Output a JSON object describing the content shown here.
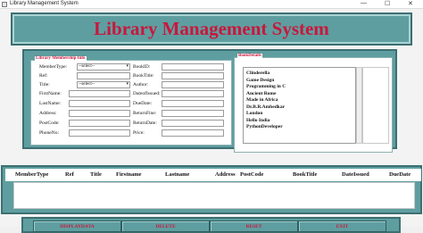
{
  "window": {
    "title": "Library Management System",
    "controls": {
      "minimize": "—",
      "maximize": "☐",
      "close": "✕"
    }
  },
  "banner": {
    "title": "Library Management System"
  },
  "member_info": {
    "legend": "Library Membership Info",
    "left_fields": [
      {
        "label": "MemberType:",
        "type": "select",
        "value": "--select--"
      },
      {
        "label": "Ref:",
        "type": "input",
        "value": ""
      },
      {
        "label": "Title:",
        "type": "select",
        "value": "--select--"
      },
      {
        "label": "FirstName:",
        "type": "input",
        "value": ""
      },
      {
        "label": "LastName:",
        "type": "input",
        "value": ""
      },
      {
        "label": "Address:",
        "type": "input",
        "value": ""
      },
      {
        "label": "PostCode:",
        "type": "input",
        "value": ""
      },
      {
        "label": "PhoneNo:",
        "type": "input",
        "value": ""
      }
    ],
    "right_fields": [
      {
        "label": "BookID:",
        "value": ""
      },
      {
        "label": "BookTitle:",
        "value": ""
      },
      {
        "label": "Author:",
        "value": ""
      },
      {
        "label": "DateofIssued:",
        "value": ""
      },
      {
        "label": "DueDate:",
        "value": ""
      },
      {
        "label": "ReturnFine:",
        "value": ""
      },
      {
        "label": "ReturnDate:",
        "value": ""
      },
      {
        "label": "Price:",
        "value": ""
      }
    ]
  },
  "book_details": {
    "legend": "BookDetails",
    "books": [
      "Clinderella",
      "Game Design",
      "Programming in C",
      "Ancient Rome",
      "Made in Africa",
      "Dr.B.R.Ambedkar",
      "London",
      "Hello India",
      "PythonDeveloper"
    ]
  },
  "table": {
    "columns": [
      "MemberType",
      "Ref",
      "Title",
      "Firstname",
      "Lastname",
      "Address",
      "PostCode",
      "BookTitle",
      "DateIssued",
      "DueDate"
    ]
  },
  "buttons": [
    "DISPLAYDATA",
    "DELETE",
    "RESET",
    "EXIT"
  ],
  "colors": {
    "accent": "#5f9ea0",
    "accent_border": "#3d6f71",
    "title_text": "#c8173d"
  }
}
